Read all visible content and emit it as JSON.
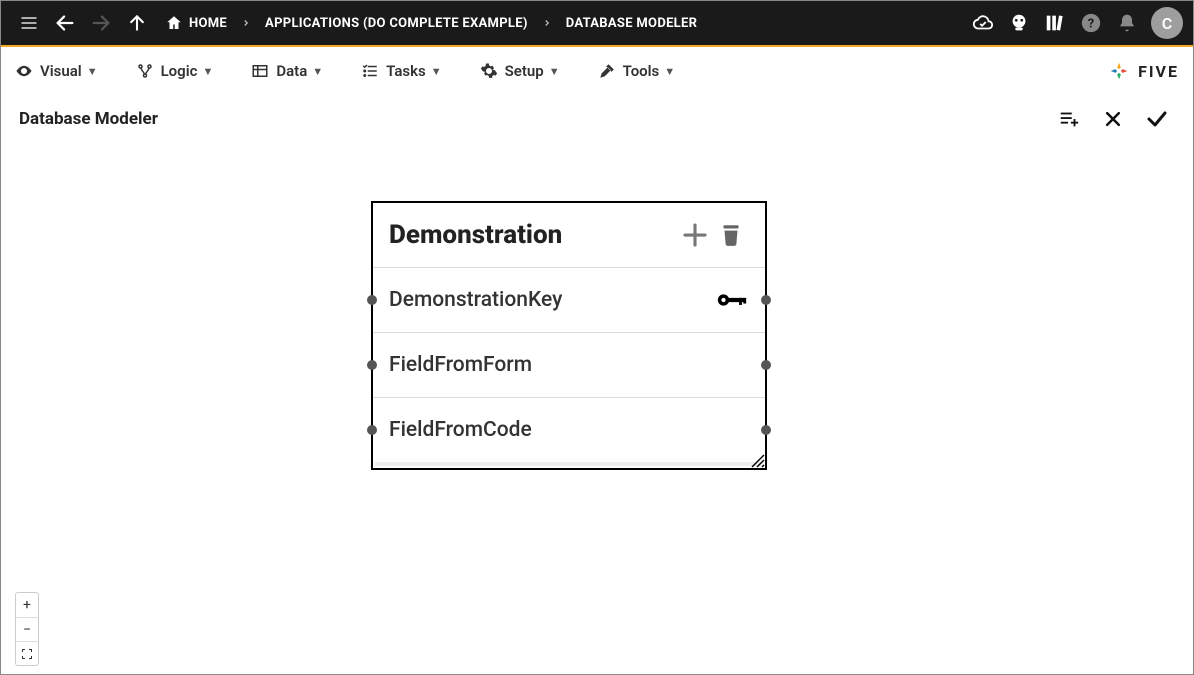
{
  "topbar": {
    "home_label": "HOME",
    "breadcrumb2": "APPLICATIONS (DO COMPLETE EXAMPLE)",
    "breadcrumb3": "DATABASE MODELER",
    "avatar_letter": "C"
  },
  "menubar": {
    "visual": "Visual",
    "logic": "Logic",
    "data": "Data",
    "tasks": "Tasks",
    "setup": "Setup",
    "tools": "Tools",
    "brand": "FIVE"
  },
  "page": {
    "title": "Database Modeler"
  },
  "table": {
    "name": "Demonstration",
    "fields": [
      {
        "name": "DemonstrationKey",
        "is_key": true
      },
      {
        "name": "FieldFromForm",
        "is_key": false
      },
      {
        "name": "FieldFromCode",
        "is_key": false
      }
    ]
  }
}
